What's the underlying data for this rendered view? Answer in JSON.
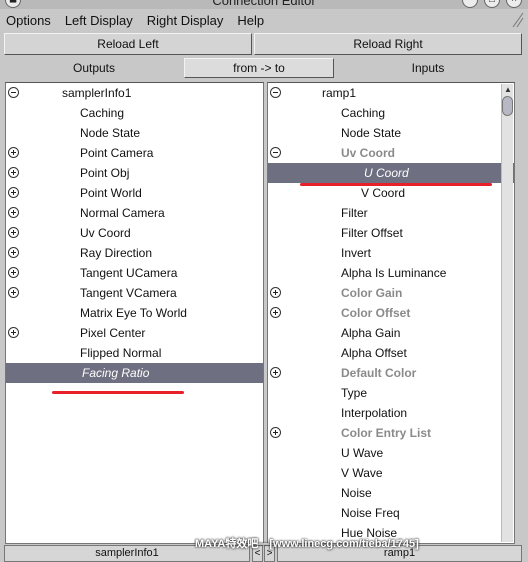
{
  "window": {
    "title": "Connection Editor"
  },
  "menubar": [
    "Options",
    "Left Display",
    "Right Display",
    "Help"
  ],
  "buttons": {
    "reload_left": "Reload Left",
    "reload_right": "Reload Right",
    "direction": "from -> to"
  },
  "headers": {
    "outputs": "Outputs",
    "inputs": "Inputs"
  },
  "left": {
    "node": "samplerInfo1",
    "attributes": [
      {
        "label": "Caching",
        "expander": "",
        "state": "normal"
      },
      {
        "label": "Node State",
        "expander": "",
        "state": "normal"
      },
      {
        "label": "Point Camera",
        "expander": "plus",
        "state": "normal"
      },
      {
        "label": "Point Obj",
        "expander": "plus",
        "state": "normal"
      },
      {
        "label": "Point World",
        "expander": "plus",
        "state": "normal"
      },
      {
        "label": "Normal Camera",
        "expander": "plus",
        "state": "normal"
      },
      {
        "label": "Uv Coord",
        "expander": "plus",
        "state": "normal"
      },
      {
        "label": "Ray Direction",
        "expander": "plus",
        "state": "normal"
      },
      {
        "label": "Tangent UCamera",
        "expander": "plus",
        "state": "normal"
      },
      {
        "label": "Tangent VCamera",
        "expander": "plus",
        "state": "normal"
      },
      {
        "label": "Matrix Eye To World",
        "expander": "",
        "state": "normal"
      },
      {
        "label": "Pixel Center",
        "expander": "plus",
        "state": "normal"
      },
      {
        "label": "Flipped Normal",
        "expander": "",
        "state": "normal"
      },
      {
        "label": "Facing Ratio",
        "expander": "",
        "state": "selected"
      }
    ]
  },
  "right": {
    "node": "ramp1",
    "attributes": [
      {
        "label": "Caching",
        "expander": "",
        "state": "normal",
        "indent": 1
      },
      {
        "label": "Node State",
        "expander": "",
        "state": "normal",
        "indent": 1
      },
      {
        "label": "Uv Coord",
        "expander": "minus",
        "state": "dim",
        "indent": 1
      },
      {
        "label": "U Coord",
        "expander": "",
        "state": "selected",
        "indent": 2
      },
      {
        "label": "V Coord",
        "expander": "",
        "state": "normal",
        "indent": 2
      },
      {
        "label": "Filter",
        "expander": "",
        "state": "normal",
        "indent": 1
      },
      {
        "label": "Filter Offset",
        "expander": "",
        "state": "normal",
        "indent": 1
      },
      {
        "label": "Invert",
        "expander": "",
        "state": "normal",
        "indent": 1
      },
      {
        "label": "Alpha Is Luminance",
        "expander": "",
        "state": "normal",
        "indent": 1
      },
      {
        "label": "Color Gain",
        "expander": "plus",
        "state": "dim",
        "indent": 1
      },
      {
        "label": "Color Offset",
        "expander": "plus",
        "state": "dim",
        "indent": 1
      },
      {
        "label": "Alpha Gain",
        "expander": "",
        "state": "normal",
        "indent": 1
      },
      {
        "label": "Alpha Offset",
        "expander": "",
        "state": "normal",
        "indent": 1
      },
      {
        "label": "Default Color",
        "expander": "plus",
        "state": "dim",
        "indent": 1
      },
      {
        "label": "Type",
        "expander": "",
        "state": "normal",
        "indent": 1
      },
      {
        "label": "Interpolation",
        "expander": "",
        "state": "normal",
        "indent": 1
      },
      {
        "label": "Color Entry List",
        "expander": "plus",
        "state": "dim",
        "indent": 1
      },
      {
        "label": "U Wave",
        "expander": "",
        "state": "normal",
        "indent": 1
      },
      {
        "label": "V Wave",
        "expander": "",
        "state": "normal",
        "indent": 1
      },
      {
        "label": "Noise",
        "expander": "",
        "state": "normal",
        "indent": 1
      },
      {
        "label": "Noise Freq",
        "expander": "",
        "state": "normal",
        "indent": 1
      },
      {
        "label": "Hue Noise",
        "expander": "",
        "state": "normal",
        "indent": 1
      }
    ]
  },
  "footer": {
    "left_node": "samplerInfo1",
    "right_node": "ramp1",
    "left_arrow": "<",
    "right_arrow": ">"
  },
  "watermark": "MAYA特效吧—[www.linecg.com/tieba/1745]",
  "colors": {
    "selected_row": "#6e6f80",
    "annotation": "#e8202a",
    "dim_text": "#8a8a8a"
  }
}
